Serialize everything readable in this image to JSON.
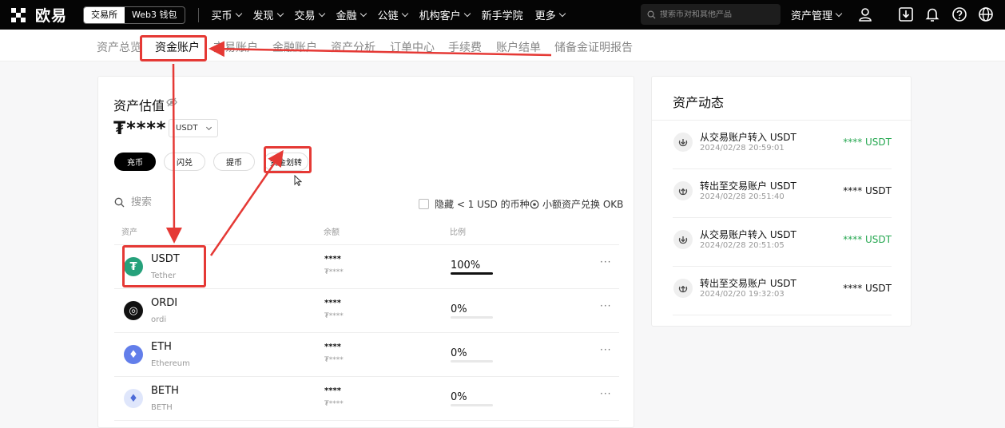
{
  "topbar": {
    "logo_text": "欧易",
    "mode_tabs": [
      "交易所",
      "Web3 钱包"
    ],
    "nav": [
      {
        "label": "买币",
        "dropdown": true
      },
      {
        "label": "发现",
        "dropdown": true
      },
      {
        "label": "交易",
        "dropdown": true
      },
      {
        "label": "金融",
        "dropdown": true
      },
      {
        "label": "公链",
        "dropdown": true
      },
      {
        "label": "机构客户",
        "dropdown": true
      },
      {
        "label": "新手学院",
        "dropdown": false
      },
      {
        "label": "更多",
        "dropdown": true
      }
    ],
    "search_placeholder": "搜索币对和其他产品",
    "asset_management": "资产管理",
    "icons": [
      "user-icon",
      "download-icon",
      "bell-icon",
      "help-icon",
      "globe-icon"
    ]
  },
  "subnav": {
    "items": [
      "资产总览",
      "资金账户",
      "交易账户",
      "金融账户",
      "资产分析",
      "订单中心",
      "手续费",
      "账户结单",
      "储备金证明报告"
    ],
    "active": "资金账户"
  },
  "main": {
    "title": "资产估值",
    "balance_mask": "₮****",
    "currency": "USDT",
    "buttons": [
      "充币",
      "闪兑",
      "提币",
      "资金划转"
    ],
    "search_placeholder": "搜索",
    "hide_small_label": "隐藏 < 1 USD 的币种",
    "small_convert_label": "小额资产兑换 OKB",
    "columns": [
      "资产",
      "余额",
      "比例"
    ],
    "assets": [
      {
        "symbol": "USDT",
        "name": "Tether",
        "balance": "****",
        "balance_sub": "₮****",
        "percent_label": "100%",
        "percent": 100,
        "color": "#26a17b",
        "glyph": "₮"
      },
      {
        "symbol": "ORDI",
        "name": "ordi",
        "balance": "****",
        "balance_sub": "₮****",
        "percent_label": "0%",
        "percent": 0,
        "color": "#111111",
        "glyph": "◎"
      },
      {
        "symbol": "ETH",
        "name": "Ethereum",
        "balance": "****",
        "balance_sub": "₮****",
        "percent_label": "0%",
        "percent": 0,
        "color": "#627eea",
        "glyph": "♦"
      },
      {
        "symbol": "BETH",
        "name": "BETH",
        "balance": "****",
        "balance_sub": "₮****",
        "percent_label": "0%",
        "percent": 0,
        "color": "#dfe6fb",
        "glyph": "♦"
      }
    ],
    "more_label": "···"
  },
  "activity": {
    "title": "资产动态",
    "items": [
      {
        "title": "从交易账户转入 USDT",
        "time": "2024/02/28 20:59:01",
        "amount": "**** USDT",
        "direction": "in",
        "color": "#25a750"
      },
      {
        "title": "转出至交易账户 USDT",
        "time": "2024/02/28 20:51:40",
        "amount": "**** USDT",
        "direction": "out",
        "color": "#111111"
      },
      {
        "title": "从交易账户转入 USDT",
        "time": "2024/02/28 20:51:05",
        "amount": "**** USDT",
        "direction": "in",
        "color": "#25a750"
      },
      {
        "title": "转出至交易账户 USDT",
        "time": "2024/02/20 19:32:03",
        "amount": "**** USDT",
        "direction": "out",
        "color": "#111111"
      }
    ]
  },
  "colors": {
    "annotation": "#e53935",
    "positive": "#25a750"
  }
}
